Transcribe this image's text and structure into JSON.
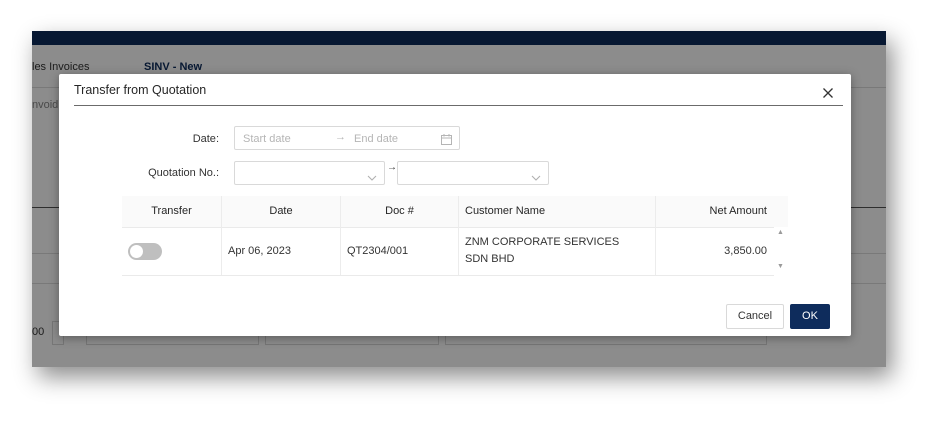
{
  "background": {
    "breadcrumb": "les Invoices",
    "doc_title": "SINV - New",
    "sub_label": "nvoid",
    "row_value": "00"
  },
  "modal": {
    "title": "Transfer from Quotation",
    "close_icon": "close-icon"
  },
  "filters": {
    "date_label": "Date",
    "date_start_placeholder": "Start date",
    "date_arrow": "→",
    "date_end_placeholder": "End date",
    "quotation_label": "Quotation No.",
    "quotation_dash": "→"
  },
  "table": {
    "columns": [
      "Transfer",
      "Date",
      "Doc #",
      "Customer Name",
      "Net Amount"
    ],
    "rows": [
      {
        "transfer": false,
        "date": "Apr 06, 2023",
        "doc_no": "QT2304/001",
        "customer": "ZNM CORPORATE SERVICES SDN BHD",
        "net_amount": "3,850.00"
      }
    ]
  },
  "footer": {
    "cancel_label": "Cancel",
    "ok_label": "OK"
  },
  "colors": {
    "primary": "#0e2c5c",
    "toggle_off": "#bfbfbf"
  }
}
